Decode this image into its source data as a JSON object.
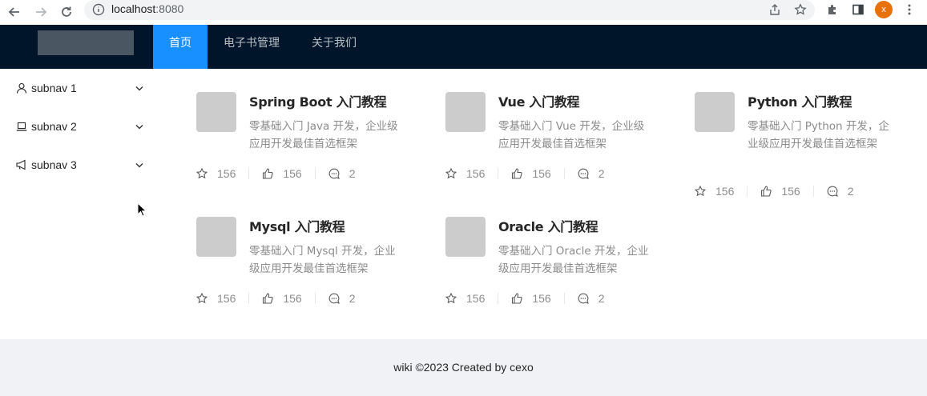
{
  "browser": {
    "url_host": "localhost",
    "url_port": ":8080",
    "avatar_letter": "x"
  },
  "header": {
    "menu": [
      {
        "label": "首页",
        "active": true
      },
      {
        "label": "电子书管理",
        "active": false
      },
      {
        "label": "关于我们",
        "active": false
      }
    ]
  },
  "sidebar": {
    "items": [
      {
        "label": "subnav 1",
        "icon": "user-icon"
      },
      {
        "label": "subnav 2",
        "icon": "laptop-icon"
      },
      {
        "label": "subnav 3",
        "icon": "notification-icon"
      }
    ]
  },
  "ebooks": [
    {
      "title": "Spring Boot 入门教程",
      "desc": "零基础入门 Java 开发，企业级应用开发最佳首选框架",
      "stars": "156",
      "likes": "156",
      "comments": "2"
    },
    {
      "title": "Vue 入门教程",
      "desc": "零基础入门 Vue 开发，企业级应用开发最佳首选框架",
      "stars": "156",
      "likes": "156",
      "comments": "2"
    },
    {
      "title": "Python 入门教程",
      "desc": "零基础入门 Python 开发，企业级应用开发最佳首选框架",
      "stars": "156",
      "likes": "156",
      "comments": "2"
    },
    {
      "title": "Mysql 入门教程",
      "desc": "零基础入门 Mysql 开发，企业级应用开发最佳首选框架",
      "stars": "156",
      "likes": "156",
      "comments": "2"
    },
    {
      "title": "Oracle 入门教程",
      "desc": "零基础入门 Oracle 开发，企业级应用开发最佳首选框架",
      "stars": "156",
      "likes": "156",
      "comments": "2"
    }
  ],
  "footer": {
    "text": "wiki ©2023 Created by cexo"
  },
  "colors": {
    "header_bg": "#001529",
    "active_menu": "#1890ff",
    "avatar": "#e8710a"
  }
}
